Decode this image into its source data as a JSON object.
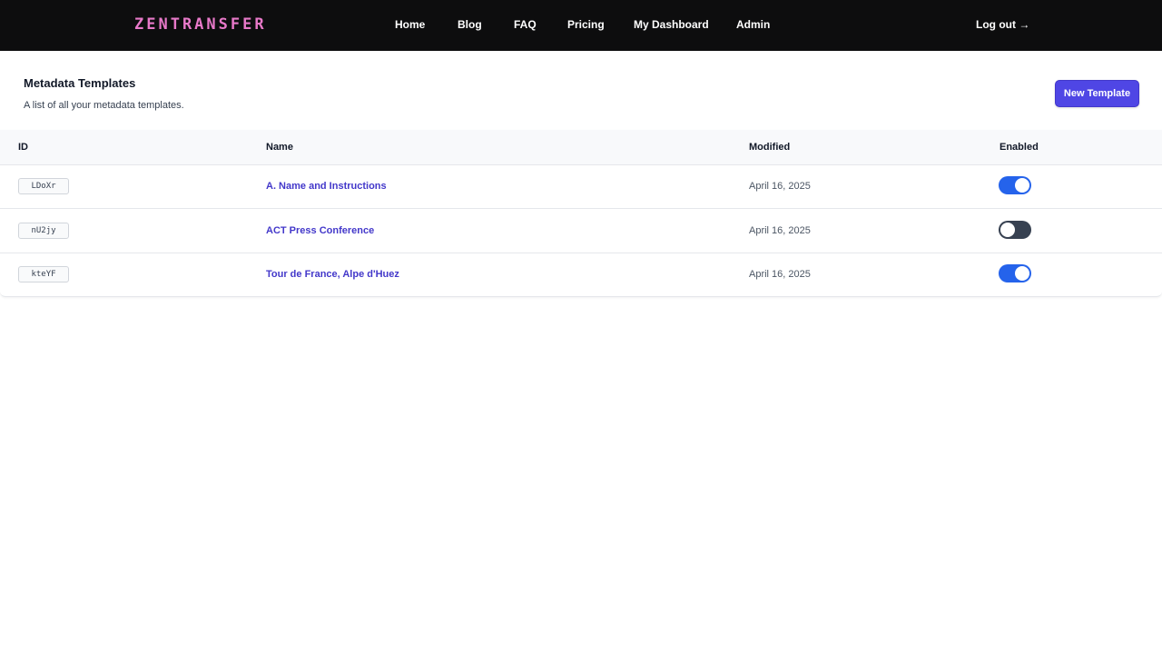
{
  "nav": {
    "logo": "ZENTRANSFER",
    "logo_color": "#e879c9",
    "links": [
      "Home",
      "Blog",
      "FAQ",
      "Pricing",
      "My Dashboard",
      "Admin"
    ],
    "logout": "Log out →"
  },
  "header": {
    "title": "Metadata Templates",
    "subtitle": "A list of all your metadata templates.",
    "new_button": "New Template",
    "accent_color": "#4f46e5"
  },
  "table": {
    "columns": [
      "ID",
      "Name",
      "Modified",
      "Enabled"
    ],
    "rows": [
      {
        "id": "LDoXr",
        "name": "A. Name and Instructions",
        "modified": "April 16, 2025",
        "enabled": true
      },
      {
        "id": "nU2jy",
        "name": "ACT Press Conference",
        "modified": "April 16, 2025",
        "enabled": false
      },
      {
        "id": "kteYF",
        "name": "Tour de France, Alpe d'Huez",
        "modified": "April 16, 2025",
        "enabled": true
      }
    ]
  },
  "colors": {
    "toggle_on": "#2563eb",
    "toggle_off": "#374151",
    "link": "#4338ca",
    "navbar": "#0d0d0e"
  }
}
